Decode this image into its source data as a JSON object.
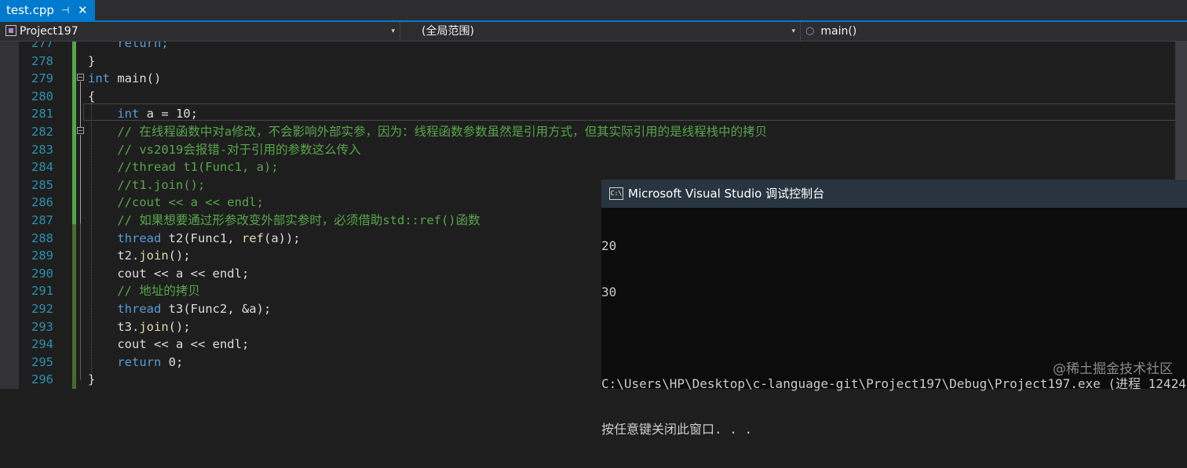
{
  "tab": {
    "title": "test.cpp",
    "pin": "⊣",
    "close": "✕"
  },
  "nav": {
    "project": "Project197",
    "scope": "(全局范围)",
    "member": "main()",
    "dropdown_glyph": "▾"
  },
  "editor": {
    "lines": [
      {
        "num": "277",
        "html_key": "l277"
      },
      {
        "num": "278",
        "html_key": "l278"
      },
      {
        "num": "279",
        "html_key": "l279"
      },
      {
        "num": "280",
        "html_key": "l280"
      },
      {
        "num": "281",
        "html_key": "l281"
      },
      {
        "num": "282",
        "html_key": "l282"
      },
      {
        "num": "283",
        "html_key": "l283"
      },
      {
        "num": "284",
        "html_key": "l284"
      },
      {
        "num": "285",
        "html_key": "l285"
      },
      {
        "num": "286",
        "html_key": "l286"
      },
      {
        "num": "287",
        "html_key": "l287"
      },
      {
        "num": "288",
        "html_key": "l288"
      },
      {
        "num": "289",
        "html_key": "l289"
      },
      {
        "num": "290",
        "html_key": "l290"
      },
      {
        "num": "291",
        "html_key": "l291"
      },
      {
        "num": "292",
        "html_key": "l292"
      },
      {
        "num": "293",
        "html_key": "l293"
      },
      {
        "num": "294",
        "html_key": "l294"
      },
      {
        "num": "295",
        "html_key": "l295"
      },
      {
        "num": "296",
        "html_key": "l296"
      }
    ],
    "tokens": {
      "l277": [
        {
          "t": "    return;",
          "c": "kw"
        }
      ],
      "l278": [
        {
          "t": "}",
          "c": ""
        }
      ],
      "l279": [
        {
          "t": "int",
          "c": "kw"
        },
        {
          "t": " main()",
          "c": ""
        }
      ],
      "l280": [
        {
          "t": "{",
          "c": ""
        }
      ],
      "l281": [
        {
          "t": "    ",
          "c": ""
        },
        {
          "t": "int",
          "c": "kw"
        },
        {
          "t": " a = 10;",
          "c": ""
        }
      ],
      "l282": [
        {
          "t": "    // 在线程函数中对a修改，不会影响外部实参，因为：线程函数参数虽然是引用方式，但其实际引用的是线程栈中的拷贝",
          "c": "cm"
        }
      ],
      "l283": [
        {
          "t": "    // vs2019会报错-对于引用的参数这么传入",
          "c": "cm"
        }
      ],
      "l284": [
        {
          "t": "    //thread t1(Func1, a);",
          "c": "cm"
        }
      ],
      "l285": [
        {
          "t": "    //t1.join();",
          "c": "cm"
        }
      ],
      "l286": [
        {
          "t": "    //cout << a << endl;",
          "c": "cm"
        }
      ],
      "l287": [
        {
          "t": "    // 如果想要通过形参改变外部实参时，必须借助std::ref()函数",
          "c": "cm"
        }
      ],
      "l288": [
        {
          "t": "    ",
          "c": ""
        },
        {
          "t": "thread",
          "c": "kw"
        },
        {
          "t": " t2(Func1, ",
          "c": ""
        },
        {
          "t": "ref",
          "c": "fn"
        },
        {
          "t": "(a));",
          "c": ""
        }
      ],
      "l289": [
        {
          "t": "    t2.",
          "c": ""
        },
        {
          "t": "join",
          "c": "fn"
        },
        {
          "t": "();",
          "c": ""
        }
      ],
      "l290": [
        {
          "t": "    cout << a << endl;",
          "c": ""
        }
      ],
      "l291": [
        {
          "t": "    // 地址的拷贝",
          "c": "cm"
        }
      ],
      "l292": [
        {
          "t": "    ",
          "c": ""
        },
        {
          "t": "thread",
          "c": "kw"
        },
        {
          "t": " t3(Func2, &a);",
          "c": ""
        }
      ],
      "l293": [
        {
          "t": "    t3.",
          "c": ""
        },
        {
          "t": "join",
          "c": "fn"
        },
        {
          "t": "();",
          "c": ""
        }
      ],
      "l294": [
        {
          "t": "    cout << a << endl;",
          "c": ""
        }
      ],
      "l295": [
        {
          "t": "    ",
          "c": ""
        },
        {
          "t": "return",
          "c": "kw"
        },
        {
          "t": " 0;",
          "c": ""
        }
      ],
      "l296": [
        {
          "t": "}",
          "c": ""
        }
      ]
    }
  },
  "console": {
    "title": "Microsoft Visual Studio 调试控制台",
    "icon_text": "C:\\",
    "output": [
      "20",
      "30",
      "",
      "C:\\Users\\HP\\Desktop\\c-language-git\\Project197\\Debug\\Project197.exe (进程 12424",
      "按任意键关闭此窗口. . ."
    ]
  },
  "watermark": "@稀土掘金技术社区",
  "colors": {
    "accent": "#007acc",
    "keyword": "#569cd6",
    "comment": "#57a64a",
    "line_number": "#2b91af"
  }
}
